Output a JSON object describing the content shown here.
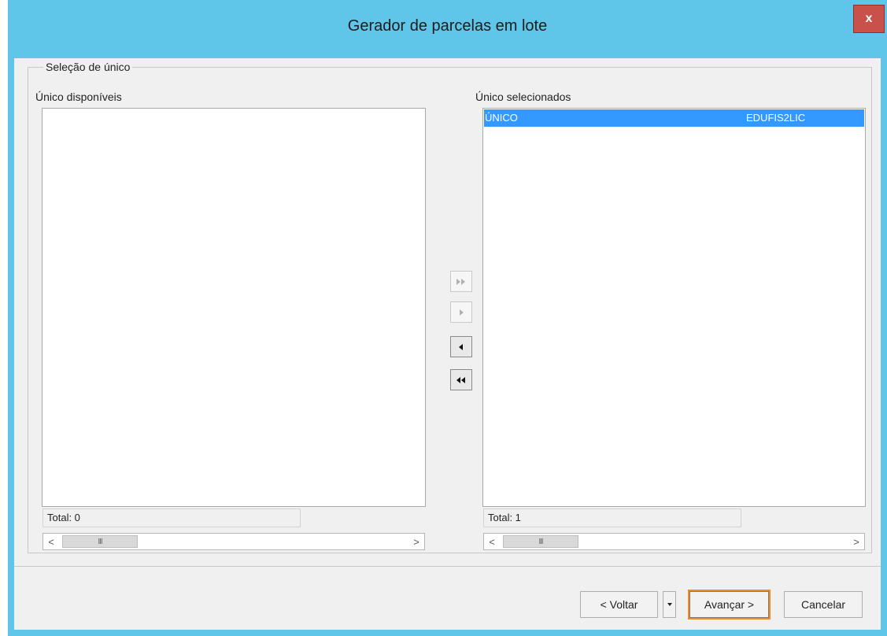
{
  "window": {
    "title": "Gerador de parcelas em lote",
    "close_label": "x"
  },
  "group": {
    "legend": "Seleção de único"
  },
  "available": {
    "label": "Único disponíveis",
    "items": [],
    "total": "Total: 0"
  },
  "selected": {
    "label": "Único selecionados",
    "rows": [
      {
        "col1": "ÚNICO",
        "col2": "EDUFIS2LIC"
      }
    ],
    "total": "Total: 1"
  },
  "scrollbar": {
    "left_arrow": "<",
    "right_arrow": ">",
    "thumb_grip": "III"
  },
  "move_buttons": {
    "add_all_icon": "double-right-arrow-icon",
    "add_one_icon": "right-arrow-icon",
    "remove_one_icon": "left-arrow-icon",
    "remove_all_icon": "double-left-arrow-icon"
  },
  "footer": {
    "back_label": "< Voltar",
    "next_label": "Avançar >",
    "cancel_label": "Cancelar"
  },
  "colors": {
    "title_bar": "#5fc6ea",
    "selection": "#3399ff",
    "default_button_border": "#f08a24",
    "close_button": "#c8524a"
  }
}
